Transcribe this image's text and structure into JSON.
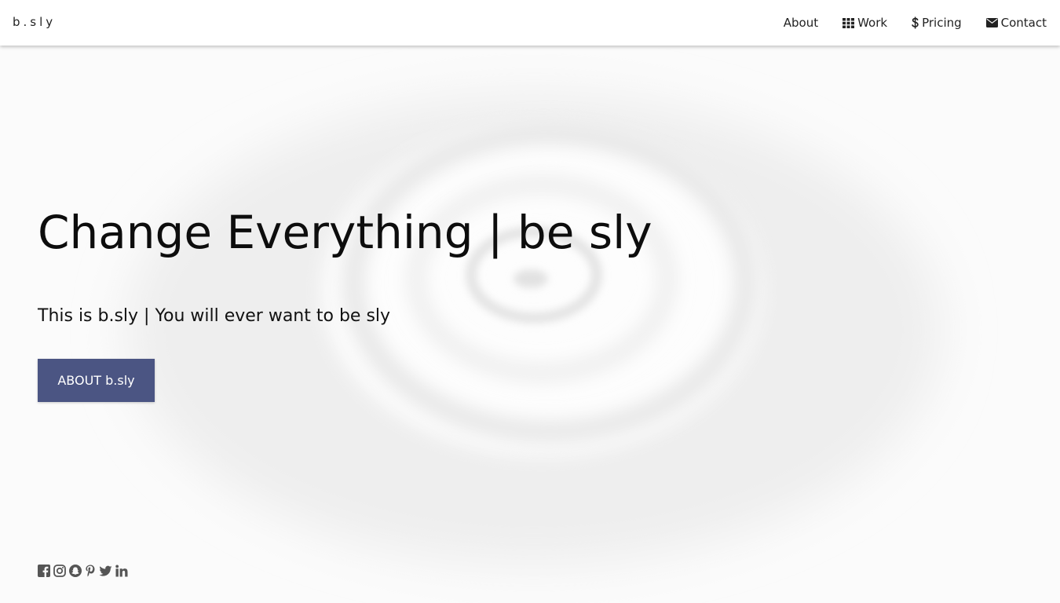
{
  "brand": "b.sly",
  "nav": {
    "items": [
      {
        "label": "About",
        "icon": ""
      },
      {
        "label": "Work",
        "icon": "grid-icon"
      },
      {
        "label": "Pricing",
        "icon": "dollar-icon"
      },
      {
        "label": "Contact",
        "icon": "envelope-icon"
      }
    ]
  },
  "hero": {
    "title": "Change Everything | be sly",
    "subtitle": "This is b.sly | You will ever want to be sly",
    "button_label": "ABOUT b.sly"
  },
  "social": [
    "facebook-icon",
    "instagram-icon",
    "snapchat-icon",
    "pinterest-icon",
    "twitter-icon",
    "linkedin-icon"
  ],
  "colors": {
    "accent": "#4b5583",
    "background": "#fbfbfb",
    "navbar": "#ffffff",
    "icon": "#555555"
  }
}
